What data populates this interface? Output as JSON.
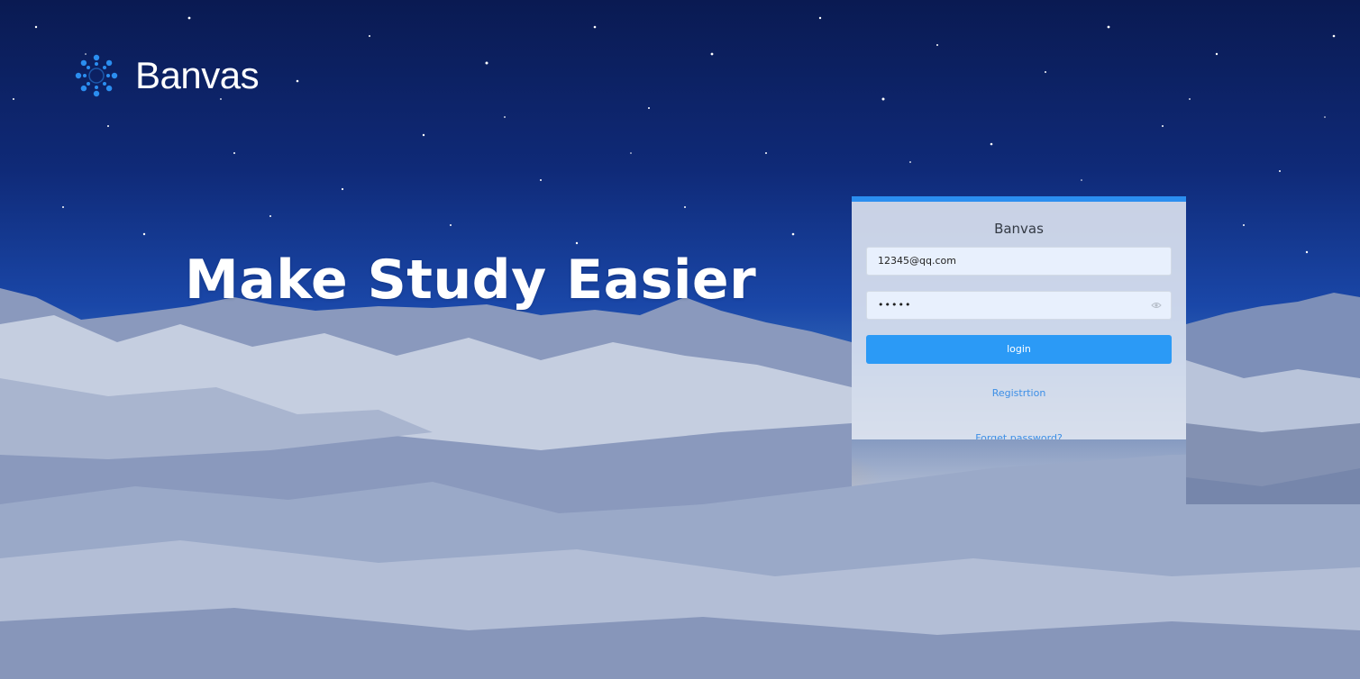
{
  "app": {
    "brand_name": "Banvas",
    "logo_icon": "canvas-dots-icon",
    "brand_color": "#2b8ef0"
  },
  "hero": {
    "headline": "Make Study Easier"
  },
  "login_card": {
    "title": "Banvas",
    "email_value": "12345@qq.com",
    "password_value": "•••••",
    "password_toggle_icon": "eye-icon",
    "login_label": "login",
    "registration_label": "Registrtion",
    "forgot_label": "Forget password?",
    "accent_color": "#2b9af6"
  }
}
